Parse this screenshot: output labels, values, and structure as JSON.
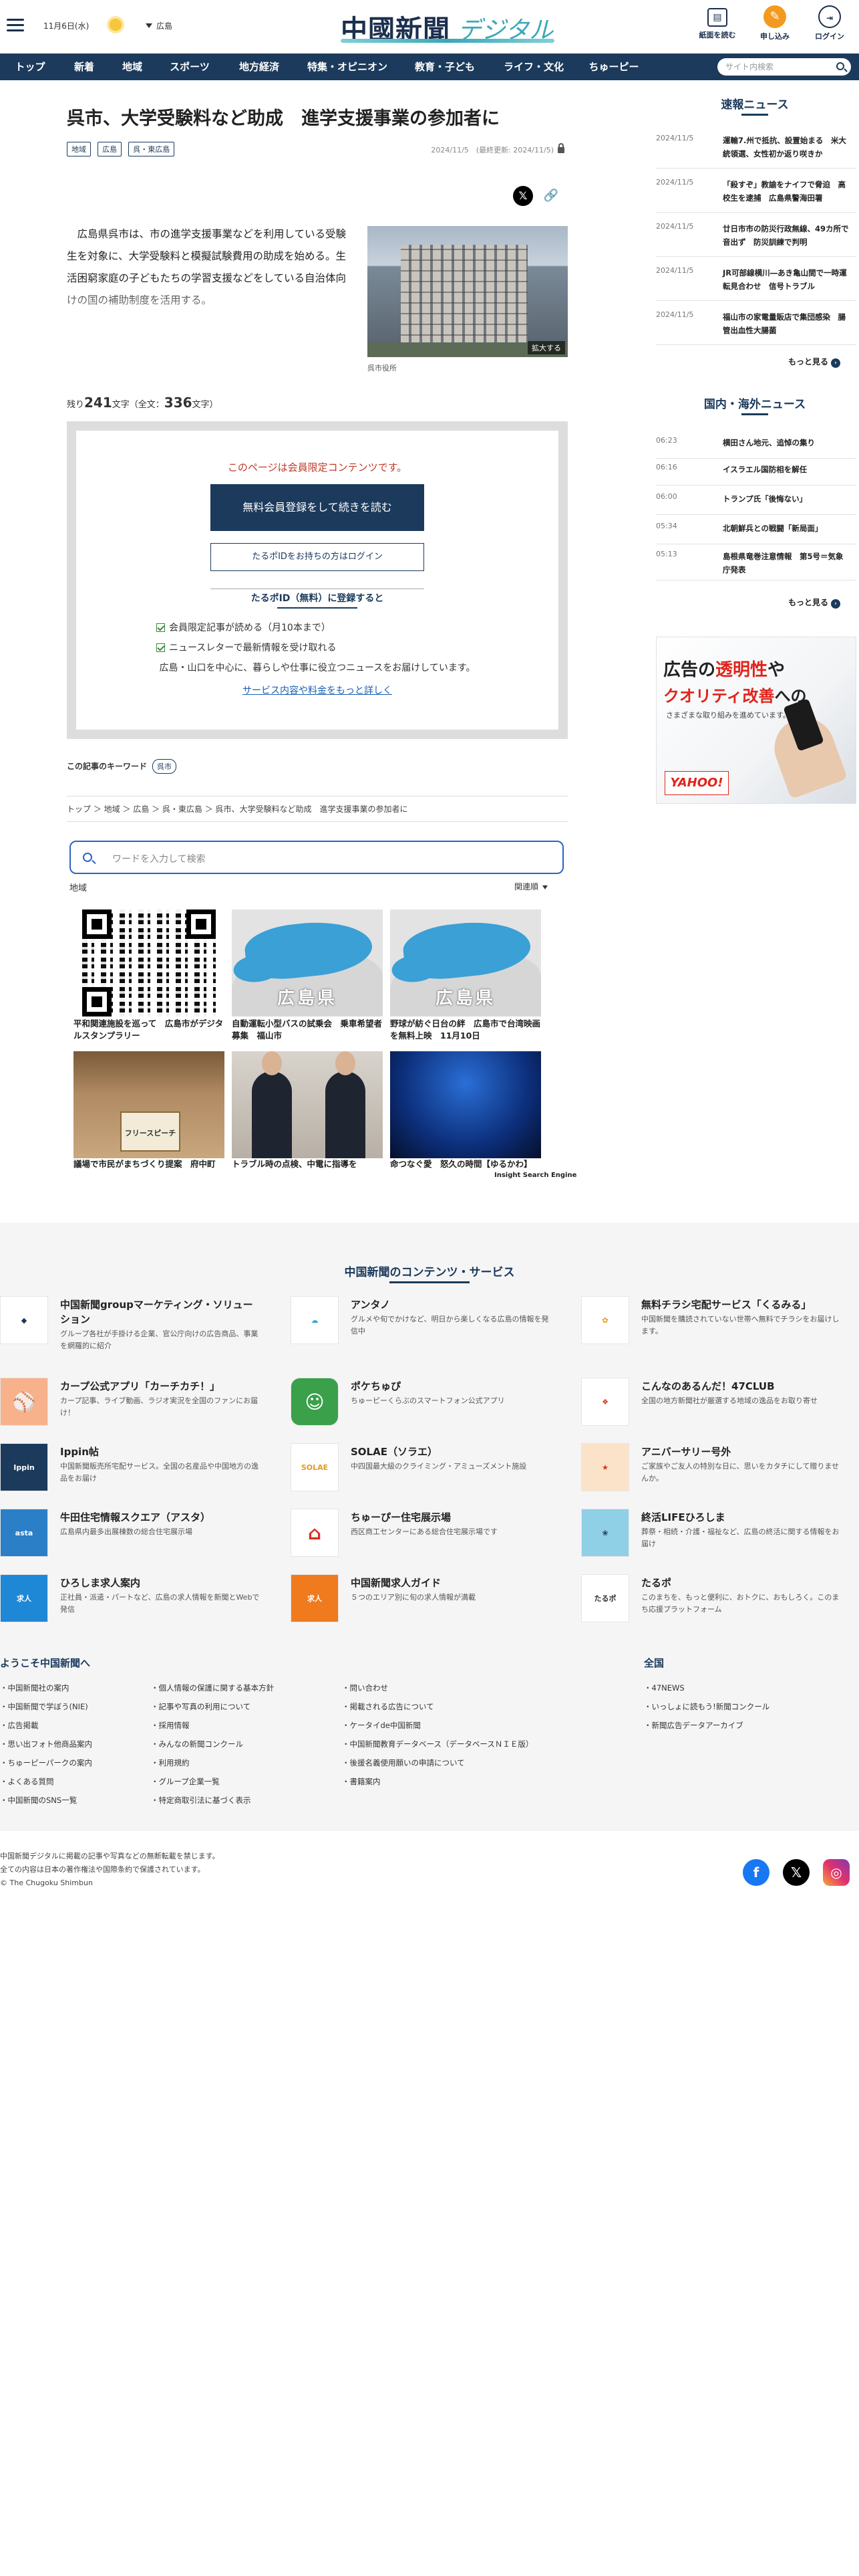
{
  "header": {
    "date": "11月6日(水)",
    "region": "広島",
    "logo_main": "中國新聞",
    "logo_sub": "デジタル",
    "btn_paper": "紙面を読む",
    "btn_subscribe": "申し込み",
    "btn_login": "ログイン"
  },
  "nav": {
    "items": [
      "トップ",
      "新着",
      "地域",
      "スポーツ",
      "地方経済",
      "特集・オピニオン",
      "教育・子ども",
      "ライフ・文化",
      "ちゅーピー"
    ],
    "search_placeholder": "サイト内検索"
  },
  "article": {
    "title": "呉市、大学受験料など助成　進学支援事業の参加者に",
    "tags": [
      "地域",
      "広島",
      "呉・東広島"
    ],
    "date": "2024/11/5　(最終更新: 2024/11/5)",
    "lead": "　広島県呉市は、市の進学支援事業などを利用している受験生を対象に、大学受験料と模擬試験費用の助成を始める。生活困窮家庭の子どもたちの学習支援などをしている自治体向けの国の補助制度を活用する。",
    "photo_enlarge": "拡大する",
    "photo_caption": "呉市役所",
    "remain_pre": "残り",
    "remain_count": "241",
    "remain_mid": "文字（全文：",
    "remain_total": "336",
    "remain_post": "文字）"
  },
  "paywall": {
    "note": "このページは会員限定コンテンツです。",
    "register_btn": "無料会員登録をして続きを読む",
    "login_btn": "たるポIDをお持ちの方はログイン",
    "register_title": "たるポID（無料）に登録すると",
    "benefit1": "会員限定記事が読める（月10本まで）",
    "benefit2": "ニュースレターで最新情報を受け取れる",
    "desc": "広島・山口を中心に、暮らしや仕事に役立つニュースをお届けしています。",
    "link": "サービス内容や料金をもっと詳しく"
  },
  "keywords": {
    "label": "この記事のキーワード",
    "items": [
      "呉市"
    ]
  },
  "breadcrumb": "トップ ＞ 地域 ＞ 広島 ＞ 呉・東広島 ＞ 呉市、大学受験料など助成　進学支援事業の参加者に",
  "search": {
    "placeholder": "ワードを入力して検索",
    "region_label": "地域",
    "sort": "関連順",
    "engine": "Insight Search Engine",
    "map_label": "広島県",
    "results": [
      {
        "caption": "平和関連施設を巡って　広島市がデジタルスタンプラリー"
      },
      {
        "caption": "自動運転小型バスの試乗会　乗車希望者募集　福山市"
      },
      {
        "caption": "野球が紡ぐ日台の絆　広島市で台湾映画を無料上映　11月10日"
      },
      {
        "caption": "議場で市民がまちづくり提案　府中町"
      },
      {
        "caption": "トラブル時の点検、中電に指導を"
      },
      {
        "caption": "命つなぐ愛　怒久の時間【ゆるかわ】"
      }
    ],
    "podium_text": "フリースピーチ"
  },
  "sidebar": {
    "breaking_title": "速報ニュース",
    "breaking": [
      {
        "time": "2024/11/5",
        "text": "運輸7.州で抵抗、設置始まる　米大統領選、女性初か返り咲きか"
      },
      {
        "time": "2024/11/5",
        "text": "「殺すぞ」教諭をナイフで脅迫　高校生を逮捕　広島県警海田署"
      },
      {
        "time": "2024/11/5",
        "text": "廿日市市の防災行政無線、49カ所で音出ず　防災訓練で判明"
      },
      {
        "time": "2024/11/5",
        "text": "JR可部線横川―あき亀山間で一時運転見合わせ　信号トラブル"
      },
      {
        "time": "2024/11/5",
        "text": "福山市の家電量販店で集団感染　腸管出血性大腸菌"
      }
    ],
    "world_title": "国内・海外ニュース",
    "world": [
      {
        "time": "06:23",
        "text": "横田さん地元、追悼の集り"
      },
      {
        "time": "06:16",
        "text": "イスラエル国防相を解任"
      },
      {
        "time": "06:00",
        "text": "トランプ氏「後悔ない」"
      },
      {
        "time": "05:34",
        "text": "北朝鮮兵との戦闘「新局面」"
      },
      {
        "time": "05:13",
        "text": "島根県竜巻注意情報　第5号＝気象庁発表"
      }
    ],
    "more": "もっと見る",
    "ad_line1a": "広告の",
    "ad_line1b": "透明性",
    "ad_line1c": "や",
    "ad_line2a": "クオリティ改善",
    "ad_line2b": "への",
    "ad_line3": "さまざまな取り組みを進めています。",
    "ad_logo": "YAHOO!"
  },
  "footer": {
    "services_title": "中国新聞のコンテンツ・サービス",
    "services": [
      {
        "title": "中国新聞groupマーケティング・ソリューション",
        "desc": "グループ各社が手掛ける企業、官公庁向けの広告商品、事業を網羅的に紹介",
        "icon": "chugoku-marketing-logo"
      },
      {
        "title": "アンタノ",
        "desc": "グルメや旬でかけなど、明日から楽しくなる広島の情報を発信中",
        "icon": "antano-logo"
      },
      {
        "title": "無料チラシ宅配サービス「くるみる」",
        "desc": "中国新聞を購読されていない世帯へ無料でチラシをお届けします。",
        "icon": "kurumiru-logo"
      },
      {
        "title": "カープ公式アプリ「カーチカチ！」",
        "desc": "カープ記事、ライブ動画、ラジオ実況を全国のファンにお届け！",
        "icon": "carp-app-logo"
      },
      {
        "title": "ポケちゅぴ",
        "desc": "ちゅーピーくらぶのスマートフォン公式アプリ",
        "icon": "pokechupi-logo"
      },
      {
        "title": "こんなのあるんだ！47CLUB",
        "desc": "全国の地方新聞社が厳選する地域の逸品をお取り寄せ",
        "icon": "47club-logo"
      },
      {
        "title": "Ippin帖",
        "desc": "中国新聞販売所宅配サービス。全国の名産品や中国地方の逸品をお届け",
        "icon": "ippin-logo"
      },
      {
        "title": "SOLAE（ソラエ）",
        "desc": "中四国最大級のクライミング・アミューズメント施設",
        "icon": "solae-logo"
      },
      {
        "title": "アニバーサリー号外",
        "desc": "ご家族やご友人の特別な日に、思いをカタチにして贈りませんか。",
        "icon": "anniversary-logo"
      },
      {
        "title": "牛田住宅情報スクエア（アスタ）",
        "desc": "広島県内最多出展棟数の総合住宅展示場",
        "icon": "asta-logo"
      },
      {
        "title": "ちゅーぴー住宅展示場",
        "desc": "西区商工センターにある総合住宅展示場です",
        "icon": "chupi-house-logo"
      },
      {
        "title": "終活LIFEひろしま",
        "desc": "葬祭・相続・介護・福祉など、広島の終活に関する情報をお届け",
        "icon": "shukatsu-logo"
      },
      {
        "title": "ひろしま求人案内",
        "desc": "正社員・派遣・パートなど、広島の求人情報を新聞とWebで発信",
        "icon": "kyujin-logo"
      },
      {
        "title": "中国新聞求人ガイド",
        "desc": "５つのエリア別に旬の求人情報が満載",
        "icon": "kyujin-guide-logo"
      },
      {
        "title": "たるポ",
        "desc": "このまちを、もっと便利に、おトクに、おもしろく。このまち応援プラットフォーム",
        "icon": "tarupo-logo"
      }
    ],
    "welcome_title": "ようこそ中国新聞へ",
    "col1": [
      "中国新聞社の案内",
      "中国新聞で学ぼう(NIE)",
      "広告掲載",
      "思い出フォト他商品案内",
      "ちゅーピーパークの案内",
      "よくある質問",
      "中国新聞のSNS一覧"
    ],
    "col2": [
      "個人情報の保護に関する基本方針",
      "記事や写真の利用について",
      "採用情報",
      "みんなの新聞コンクール",
      "利用規約",
      "グループ企業一覧",
      "特定商取引法に基づく表示"
    ],
    "col3": [
      "問い合わせ",
      "掲載される広告について",
      "ケータイde中国新聞",
      "中国新聞教育データベース（データベースＮＩＥ版）",
      "後援名義使用願いの申請について",
      "書籍案内"
    ],
    "zenkoku_title": "全国",
    "col4": [
      "47NEWS",
      "いっしょに読もう!新聞コンクール",
      "新聞広告データアーカイブ"
    ],
    "copy1": "中国新聞デジタルに掲載の記事や写真などの無断転載を禁じます。",
    "copy2": "全ての内容は日本の著作権法や国際条約で保護されています。",
    "copy3": "© The Chugoku Shimbun",
    "sns": {
      "fb": "f",
      "x": "𝕏",
      "ig": "◎"
    }
  },
  "colors": {
    "navy": "#1b3a5c",
    "accent": "#f39a1e",
    "link": "#1a5fb4",
    "alert": "#c0392b"
  }
}
